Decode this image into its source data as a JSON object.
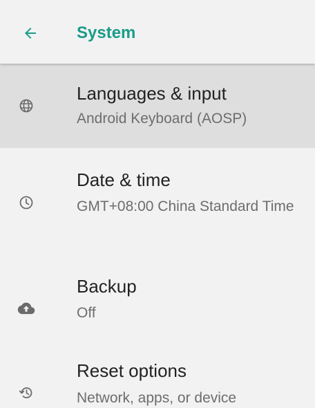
{
  "app_bar": {
    "title": "System",
    "back_icon": "arrow-back-icon",
    "accent_color": "#1a9c8a"
  },
  "items": [
    {
      "title": "Languages & input",
      "summary": "Android Keyboard (AOSP)",
      "icon": "globe-icon",
      "highlighted": true
    },
    {
      "title": "Date & time",
      "summary": "GMT+08:00 China Standard Time",
      "icon": "clock-icon",
      "highlighted": false
    },
    {
      "title": "Backup",
      "summary": "Off",
      "icon": "cloud-upload-icon",
      "highlighted": false
    },
    {
      "title": "Reset options",
      "summary": "Network, apps, or device",
      "icon": "restore-icon",
      "highlighted": false
    }
  ]
}
